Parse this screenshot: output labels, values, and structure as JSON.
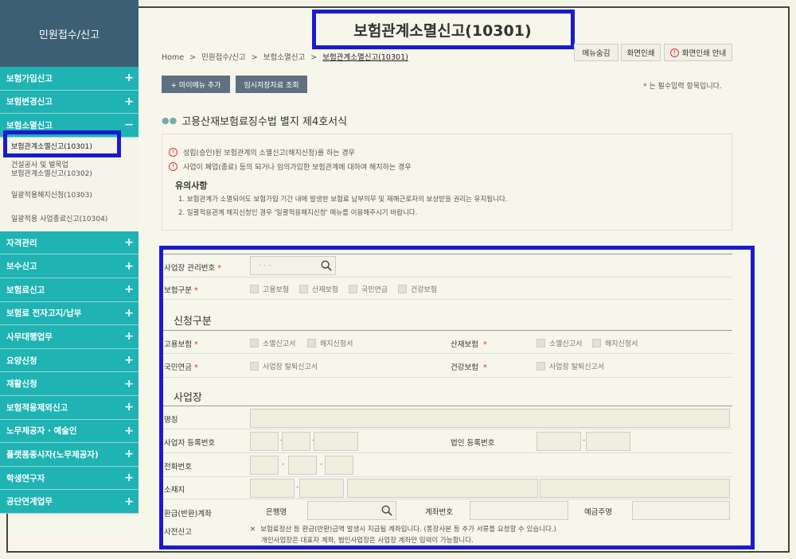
{
  "sidebar": {
    "title": "민원접수/신고",
    "menu_top": [
      {
        "label": "보험가입신고",
        "sign": "+"
      },
      {
        "label": "보험변경신고",
        "sign": "+"
      },
      {
        "label": "보험소멸신고",
        "sign": "−"
      }
    ],
    "submenu": [
      "보험관계소멸신고(10301)",
      "건설공사 및 벌목업",
      "보험관계소멸신고(10302)",
      "일괄적용해지신청(10303)",
      "일괄적용 사업종료신고(10304)"
    ],
    "menu_bottom": [
      {
        "label": "자격관리",
        "sign": "+"
      },
      {
        "label": "보수신고",
        "sign": "+"
      },
      {
        "label": "보험료신고",
        "sign": "+"
      },
      {
        "label": "보험료 전자고지/납부",
        "sign": "+"
      },
      {
        "label": "사무대행업무",
        "sign": "+"
      },
      {
        "label": "요양신청",
        "sign": "+"
      },
      {
        "label": "재활신청",
        "sign": "+"
      },
      {
        "label": "보험적용제외신고",
        "sign": "+"
      },
      {
        "label": "노무제공자 · 예술인",
        "sign": "+"
      },
      {
        "label": "플랫폼종사자(노무제공자)",
        "sign": "+"
      },
      {
        "label": "학생연구자",
        "sign": "+"
      },
      {
        "label": "공단연계업무",
        "sign": "+"
      }
    ]
  },
  "page": {
    "title": "보험관계소멸신고(10301)",
    "breadcrumb": [
      "Home",
      ">",
      "민원접수/신고",
      ">",
      "보험소멸신고",
      ">",
      "보험관계소멸신고(10301)"
    ],
    "top_buttons": [
      "메뉴숨김",
      "화면인쇄",
      "화면인쇄 안내"
    ],
    "action_buttons": [
      "+ 마이메뉴 추가",
      "임시저장자료 조회"
    ],
    "required_note": "* 는 필수입력 항목입니다.",
    "section_title": "고용산재보험료징수법 별지 제4호서식"
  },
  "info": {
    "warnings": [
      "성립(승인)된 보험관계의 소멸신고(해지신청)를 하는 경우",
      "사업이 폐업(종료) 등의 되거나 임의가입한 보험관계에 대하여 해지하는 경우"
    ],
    "caution_title": "유의사항",
    "caution_lines": [
      "1. 보험관계가 소멸되어도 보험가입 기간 내에 발생한 보험료 납부의무 및 재해근로자의 보상받을 권리는 유지됩니다.",
      "2. 일괄적용관계 해지신청인 경우 '일괄적용해지신청' 메뉴를 이용해주시기 바랍니다."
    ]
  },
  "form": {
    "mgmt_no_label": "사업장 관리번호",
    "mgmt_no_placeholder": "-  -  -",
    "insurance_type_label": "보험구분",
    "insurance_types": [
      "고용보험",
      "산재보험",
      "국민연금",
      "건강보험"
    ],
    "apply_group": "신청구분",
    "employment_label": "고용보험",
    "employment_opts": [
      "소멸신고서",
      "해지신청서"
    ],
    "industrial_label": "산재보험",
    "industrial_opts": [
      "소멸신고서",
      "해지신청서"
    ],
    "pension_label": "국민연금",
    "pension_opt": "사업장 탈퇴신고서",
    "health_label": "건강보험",
    "health_opt": "사업장 탈퇴신고서",
    "biz_group": "사업장",
    "name_label": "명칭",
    "biz_reg_label": "사업자 등록번호",
    "corp_reg_label": "법인 등록번호",
    "phone_label": "전화번호",
    "address_label": "소재지",
    "refund_label_1": "환급(반환)계좌",
    "refund_label_2": "사전신고",
    "bank_label": "은행명",
    "account_label": "계좌번호",
    "holder_label": "예금주명",
    "refund_note_1": "보험료정산 등 환급(반환)금액 발생시 지급될 계좌입니다. (통장사본 등 추가 서류를 요청할 수 있습니다.)",
    "refund_note_2": "개인사업장은 대표자 계좌, 법인사업장은 사업장 계좌만 입력이 가능합니다.",
    "dash": "-"
  },
  "colors": {
    "sidebar_menu": "#1fb3b3",
    "sidebar_head": "#3d5f74",
    "highlight": "#1a1ad0",
    "required": "#d33333"
  }
}
